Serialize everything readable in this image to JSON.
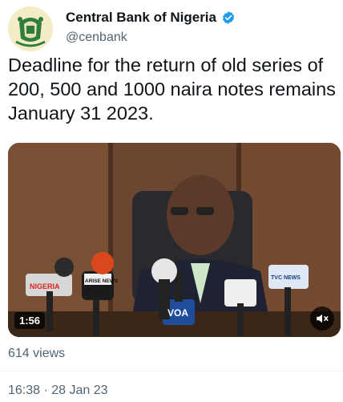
{
  "author": {
    "name": "Central Bank of Nigeria",
    "handle": "@cenbank",
    "verified": true,
    "avatar_icon": "cbn-logo-icon"
  },
  "tweet": {
    "text": "Deadline for the return of old series of 200, 500 and 1000 naira notes remains January 31 2023."
  },
  "video": {
    "duration": "1:56",
    "muted": true,
    "mute_icon": "speaker-muted-icon",
    "mic_labels": [
      "NIGERIA",
      "ARISE NEWS",
      "VOA",
      "TVC NEWS"
    ]
  },
  "stats": {
    "views": "614 views"
  },
  "meta": {
    "timestamp": "16:38 · 28 Jan 23"
  },
  "colors": {
    "verified": "#1d9bf0",
    "secondary_text": "#536471",
    "primary_text": "#0f1419"
  }
}
